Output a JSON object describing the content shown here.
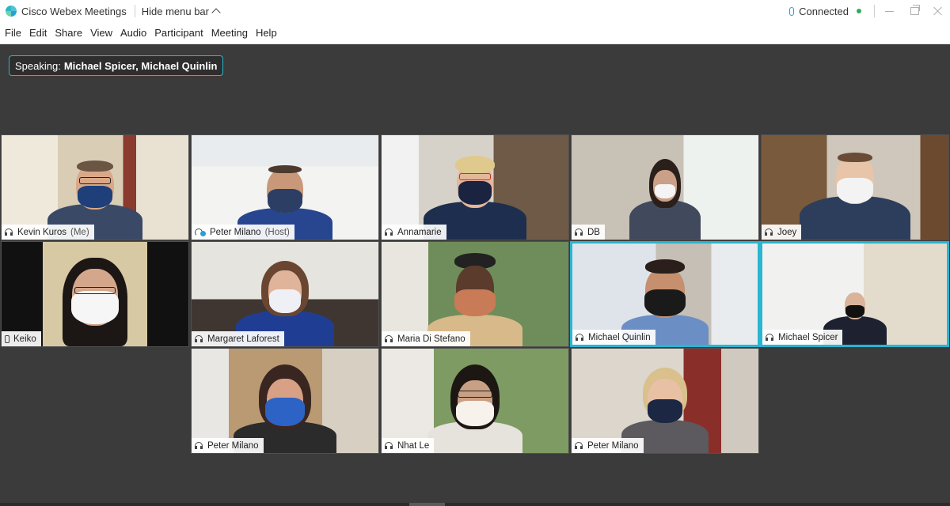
{
  "titlebar": {
    "app_title": "Cisco Webex Meetings",
    "hide_menu_label": "Hide menu bar",
    "status": "Connected",
    "status_color": "#3aa757"
  },
  "menu": [
    "File",
    "Edit",
    "Share",
    "View",
    "Audio",
    "Participant",
    "Meeting",
    "Help"
  ],
  "speaking": {
    "prefix": "Speaking:",
    "names": "Michael Spicer, Michael Quinlin"
  },
  "accent_color": "#2ab5d1",
  "participants": [
    {
      "name": "Kevin Kuros",
      "role": "(Me)",
      "audio_icon": "headset-icon"
    },
    {
      "name": "Peter Milano",
      "role": "(Host)",
      "audio_icon": "host-icon"
    },
    {
      "name": "Annamarie",
      "role": "",
      "audio_icon": "headset-icon"
    },
    {
      "name": "DB",
      "role": "",
      "audio_icon": "headset-icon"
    },
    {
      "name": "Joey",
      "role": "",
      "audio_icon": "headset-icon"
    },
    {
      "name": "Keiko",
      "role": "",
      "audio_icon": "phone-icon"
    },
    {
      "name": "Margaret Laforest",
      "role": "",
      "audio_icon": "headset-icon"
    },
    {
      "name": "Maria Di Stefano",
      "role": "",
      "audio_icon": "headset-icon"
    },
    {
      "name": "Michael Quinlin",
      "role": "",
      "audio_icon": "headset-icon",
      "speaking": true
    },
    {
      "name": "Michael Spicer",
      "role": "",
      "audio_icon": "headset-icon",
      "speaking": true
    },
    {
      "name": "Peter Milano",
      "role": "",
      "audio_icon": "headset-icon"
    },
    {
      "name": "Nhat Le",
      "role": "",
      "audio_icon": "headset-icon"
    },
    {
      "name": "Peter Milano",
      "role": "",
      "audio_icon": "headset-icon"
    }
  ]
}
